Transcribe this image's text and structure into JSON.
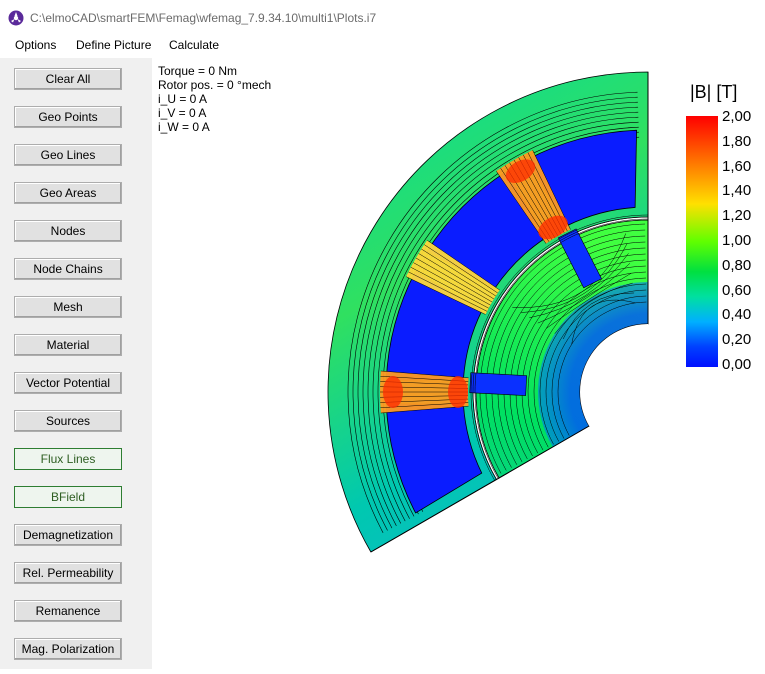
{
  "window": {
    "title": "C:\\elmoCAD\\smartFEM\\Femag\\wfemag_7.9.34.10\\multi1\\Plots.i7"
  },
  "menu": {
    "options": "Options",
    "define_picture": "Define Picture",
    "calculate": "Calculate"
  },
  "buttons": [
    {
      "label": "Clear All",
      "active": false
    },
    {
      "label": "Geo Points",
      "active": false
    },
    {
      "label": "Geo Lines",
      "active": false
    },
    {
      "label": "Geo Areas",
      "active": false
    },
    {
      "label": "Nodes",
      "active": false
    },
    {
      "label": "Node Chains",
      "active": false
    },
    {
      "label": "Mesh",
      "active": false
    },
    {
      "label": "Material",
      "active": false
    },
    {
      "label": "Vector Potential",
      "active": false
    },
    {
      "label": "Sources",
      "active": false
    },
    {
      "label": "Flux Lines",
      "active": true
    },
    {
      "label": "BField",
      "active": true
    },
    {
      "label": "Demagnetization",
      "active": false
    },
    {
      "label": "Rel. Permeability",
      "active": false
    },
    {
      "label": "Remanence",
      "active": false
    },
    {
      "label": "Mag. Polarization",
      "active": false
    }
  ],
  "info": {
    "torque": "Torque = 0 Nm",
    "rotor_pos": "Rotor pos. = 0 °mech",
    "i_u": "i_U = 0 A",
    "i_v": "i_V = 0 A",
    "i_w": "i_W = 0 A"
  },
  "legend": {
    "title": "|B| [T]",
    "ticks": [
      "2,00",
      "1,80",
      "1,60",
      "1,40",
      "1,20",
      "1,00",
      "0,80",
      "0,60",
      "0,40",
      "0,20",
      "0,00"
    ],
    "colors": [
      "#ff1a00",
      "#ff7a00",
      "#ffd000",
      "#a0ff00",
      "#00e04a",
      "#00d8a8",
      "#00a8ff",
      "#0030ff"
    ]
  }
}
